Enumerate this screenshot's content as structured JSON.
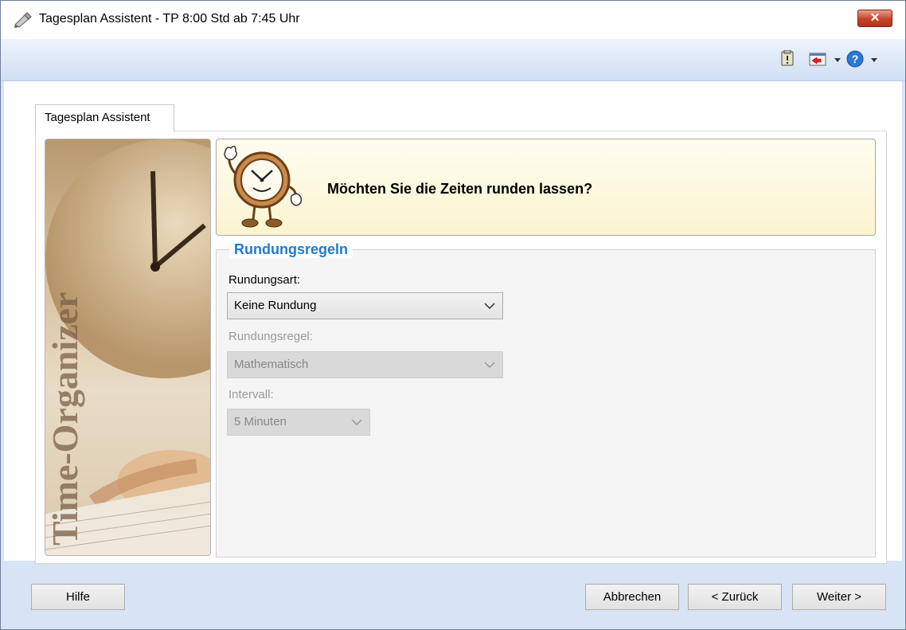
{
  "window": {
    "title": "Tagesplan Assistent - TP 8:00 Std ab 7:45 Uhr",
    "close_label": "✕"
  },
  "toolbar": {
    "icons": [
      "clipboard-icon",
      "exit-icon",
      "dropdown-arrow-icon",
      "help-icon",
      "dropdown-arrow-icon"
    ]
  },
  "tabs": [
    {
      "label": "Tagesplan Assistent",
      "active": true
    }
  ],
  "side_image": {
    "text": "Time-Organizer"
  },
  "header": {
    "question": "Möchten Sie die Zeiten runden lassen?"
  },
  "group": {
    "title": "Rundungsregeln",
    "fields": {
      "rundungsart": {
        "label": "Rundungsart:",
        "value": "Keine Rundung",
        "enabled": true
      },
      "rundungsregel": {
        "label": "Rundungsregel:",
        "value": "Mathematisch",
        "enabled": false
      },
      "intervall": {
        "label": "Intervall:",
        "value": "5 Minuten",
        "enabled": false
      }
    }
  },
  "buttons": {
    "help": "Hilfe",
    "cancel": "Abbrechen",
    "back": "< Zurück",
    "next": "Weiter >"
  },
  "colors": {
    "accent": "#1e7ad1",
    "toolbar_bg": "#d6e4f5",
    "header_bg": "#fbf4cf",
    "close_button": "#c4442b"
  }
}
